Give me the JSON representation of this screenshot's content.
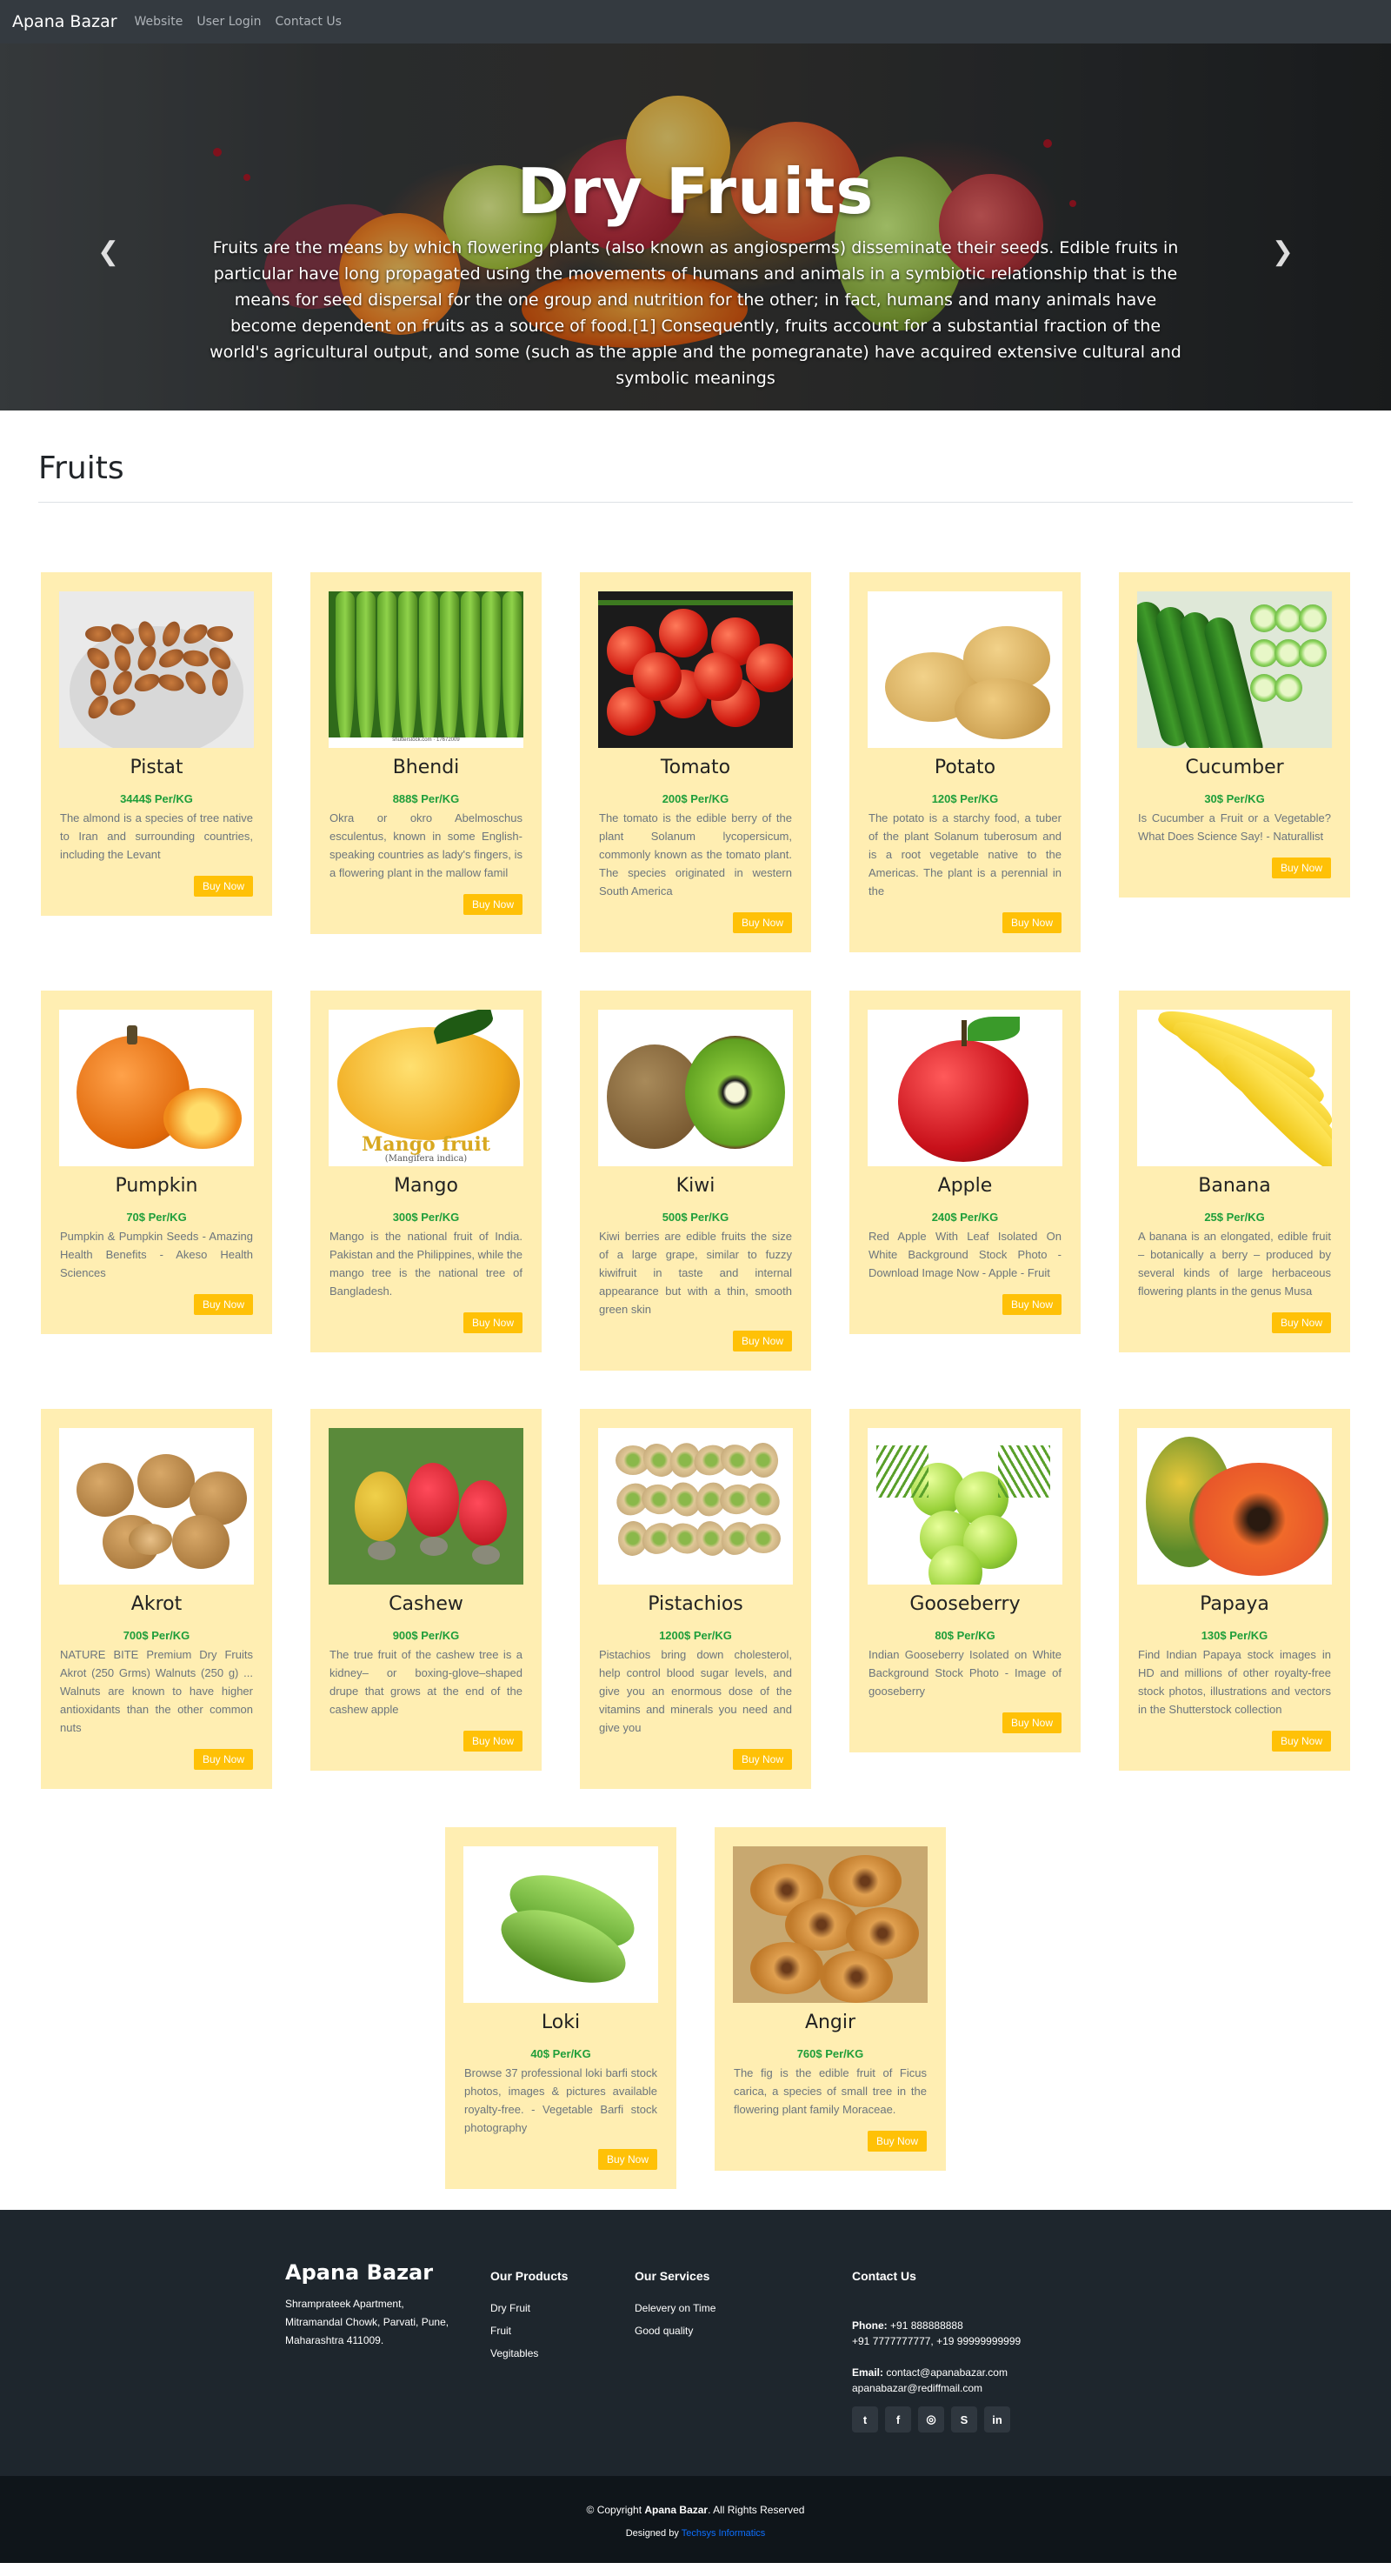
{
  "navbar": {
    "brand": "Apana Bazar",
    "links": [
      "Website",
      "User Login",
      "Contact Us"
    ]
  },
  "hero": {
    "title": "Dry Fruits",
    "text": "Fruits are the means by which flowering plants (also known as angiosperms) disseminate their seeds. Edible fruits in particular have long propagated using the movements of humans and animals in a symbiotic relationship that is the means for seed dispersal for the one group and nutrition for the other; in fact, humans and many animals have become dependent on fruits as a source of food.[1] Consequently, fruits account for a substantial fraction of the world's agricultural output, and some (such as the apple and the pomegranate) have acquired extensive cultural and symbolic meanings",
    "prev_icon": "chevron-left-icon",
    "next_icon": "chevron-right-icon",
    "active_slide": 2,
    "slide_count": 5
  },
  "section": {
    "title": "Fruits"
  },
  "buy_label": "Buy Now",
  "products": [
    {
      "name": "Pistat",
      "price": "3444$ Per/KG",
      "desc": "The almond is a species of tree native to Iran and surrounding countries, including the Levant",
      "img": "almonds"
    },
    {
      "name": "Bhendi",
      "price": "888$ Per/KG",
      "desc": "Okra or okro Abelmoschus esculentus, known in some English-speaking countries as lady's fingers, is a flowering plant in the mallow famil",
      "img": "okra"
    },
    {
      "name": "Tomato",
      "price": "200$ Per/KG",
      "desc": "The tomato is the edible berry of the plant Solanum lycopersicum, commonly known as the tomato plant. The species originated in western South America",
      "img": "tomatoes"
    },
    {
      "name": "Potato",
      "price": "120$ Per/KG",
      "desc": "The potato is a starchy food, a tuber of the plant Solanum tuberosum and is a root vegetable native to the Americas. The plant is a perennial in the",
      "img": "potatoes"
    },
    {
      "name": "Cucumber",
      "price": "30$ Per/KG",
      "desc": "Is Cucumber a Fruit or a Vegetable? What Does Science Say! - Naturallist",
      "img": "cucumbers"
    },
    {
      "name": "Pumpkin",
      "price": "70$ Per/KG",
      "desc": "Pumpkin & Pumpkin Seeds - Amazing Health Benefits - Akeso Health Sciences",
      "img": "pumpkin"
    },
    {
      "name": "Mango",
      "price": "300$ Per/KG",
      "desc": "Mango is the national fruit of India. Pakistan and the Philippines, while the mango tree is the national tree of Bangladesh.",
      "img": "mango"
    },
    {
      "name": "Kiwi",
      "price": "500$ Per/KG",
      "desc": "Kiwi berries are edible fruits the size of a large grape, similar to fuzzy kiwifruit in taste and internal appearance but with a thin, smooth green skin",
      "img": "kiwi"
    },
    {
      "name": "Apple",
      "price": "240$ Per/KG",
      "desc": "Red Apple With Leaf Isolated On White Background Stock Photo - Download Image Now - Apple - Fruit",
      "img": "apple"
    },
    {
      "name": "Banana",
      "price": "25$ Per/KG",
      "desc": "A banana is an elongated, edible fruit – botanically a berry – produced by several kinds of large herbaceous flowering plants in the genus Musa",
      "img": "banana"
    },
    {
      "name": "Akrot",
      "price": "700$ Per/KG",
      "desc": "NATURE BITE Premium Dry Fruits Akrot (250 Grms) Walnuts (250 g) ... Walnuts are known to have higher antioxidants than the other common nuts",
      "img": "walnuts"
    },
    {
      "name": "Cashew",
      "price": "900$ Per/KG",
      "desc": "The true fruit of the cashew tree is a kidney– or boxing-glove–shaped drupe that grows at the end of the cashew apple",
      "img": "cashew"
    },
    {
      "name": "Pistachios",
      "price": "1200$ Per/KG",
      "desc": "Pistachios bring down cholesterol, help control blood sugar levels, and give you an enormous dose of the vitamins and minerals you need and give you",
      "img": "pistachios"
    },
    {
      "name": "Gooseberry",
      "price": "80$ Per/KG",
      "desc": "Indian Gooseberry Isolated on White Background Stock Photo - Image of gooseberry",
      "img": "gooseberry"
    },
    {
      "name": "Papaya",
      "price": "130$ Per/KG",
      "desc": "Find Indian Papaya stock images in HD and millions of other royalty-free stock photos, illustrations and vectors in the Shutterstock collection",
      "img": "papaya"
    },
    {
      "name": "Loki",
      "price": "40$ Per/KG",
      "desc": "Browse 37 professional loki barfi stock photos, images & pictures available royalty-free. - Vegetable Barfi stock photography",
      "img": "loki"
    },
    {
      "name": "Angir",
      "price": "760$ Per/KG",
      "desc": "The fig is the edible fruit of Ficus carica, a species of small tree in the flowering plant family Moraceae.",
      "img": "figs"
    }
  ],
  "image_text": {
    "okra_watermark": "shutterstock.com · 17672009",
    "mango_caption": "Mango fruit",
    "mango_latin": "(Mangifera indica)"
  },
  "footer": {
    "brand": "Apana Bazar",
    "address": "Shramprateek Apartment, Mitramandal Chowk, Parvati, Pune, Maharashtra 411009.",
    "products_head": "Our Products",
    "products": [
      "Dry Fruit",
      "Fruit",
      "Vegitables"
    ],
    "services_head": "Our Services",
    "services": [
      "Delevery on Time",
      "Good quality"
    ],
    "contact_head": "Contact Us",
    "phone_label": "Phone:",
    "phone_1": " +91 888888888",
    "phone_2": "+91 7777777777, +19 99999999999",
    "email_label": "Email:",
    "email_1": " contact@apanabazar.com",
    "email_2": "apanabazar@rediffmail.com",
    "social": [
      {
        "icon": "twitter-icon",
        "glyph": "t"
      },
      {
        "icon": "facebook-icon",
        "glyph": "f"
      },
      {
        "icon": "instagram-icon",
        "glyph": "◎"
      },
      {
        "icon": "skype-icon",
        "glyph": "S"
      },
      {
        "icon": "linkedin-icon",
        "glyph": "in"
      }
    ]
  },
  "copyright": {
    "prefix": "© Copyright ",
    "brand": "Apana Bazar",
    "suffix": ". All Rights Reserved",
    "designed_by": "Designed by ",
    "designer": "Techsys Informatics"
  },
  "colors": {
    "card_bg": "#ffeeb2",
    "price": "#1e9e3a",
    "buy_button": "#ffc107",
    "navbar": "#343a40",
    "footer": "#1e262d"
  }
}
